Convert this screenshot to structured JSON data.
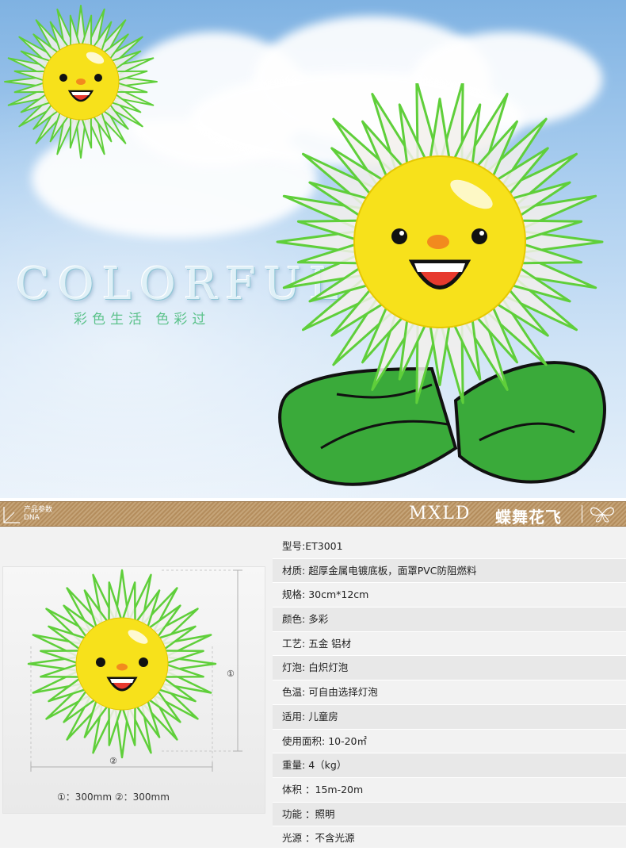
{
  "hero": {
    "headline": "COLORFUL",
    "slogan": "彩色生活 色彩过"
  },
  "bar": {
    "section_zh": "产品参数",
    "section_en": "DNA",
    "brand_en": "MXLD",
    "brand_zh": "蝶舞花飞"
  },
  "figure": {
    "marker_height": "①",
    "marker_width": "②",
    "dims_text": "①：300mm  ②：300mm"
  },
  "specs": [
    {
      "label": "型号:",
      "value": "ET3001"
    },
    {
      "label": "材质:",
      "value": " 超厚金属电镀底板，面罩PVC防阻燃料"
    },
    {
      "label": "规格:",
      "value": " 30cm*12cm"
    },
    {
      "label": "颜色:",
      "value": " 多彩"
    },
    {
      "label": "工艺:",
      "value": " 五金 铝材"
    },
    {
      "label": "灯泡:",
      "value": " 白炽灯泡"
    },
    {
      "label": "色温:",
      "value": " 可自由选择灯泡"
    },
    {
      "label": "适用:",
      "value": " 儿童房"
    },
    {
      "label": "使用面积:",
      "value": " 10-20㎡"
    },
    {
      "label": "重量:",
      "value": " 4（kg）"
    },
    {
      "label": "体积",
      "value": " ：15m-20m"
    },
    {
      "label": "功能",
      "value": " ：照明"
    },
    {
      "label": "光源",
      "value": " ：不含光源"
    }
  ],
  "colors": {
    "petal_stroke": "#5fcf3a",
    "face": "#f7e11b",
    "leaf": "#3aaa3a",
    "bar": "#b48d5d",
    "slogan": "#5cc28b"
  }
}
